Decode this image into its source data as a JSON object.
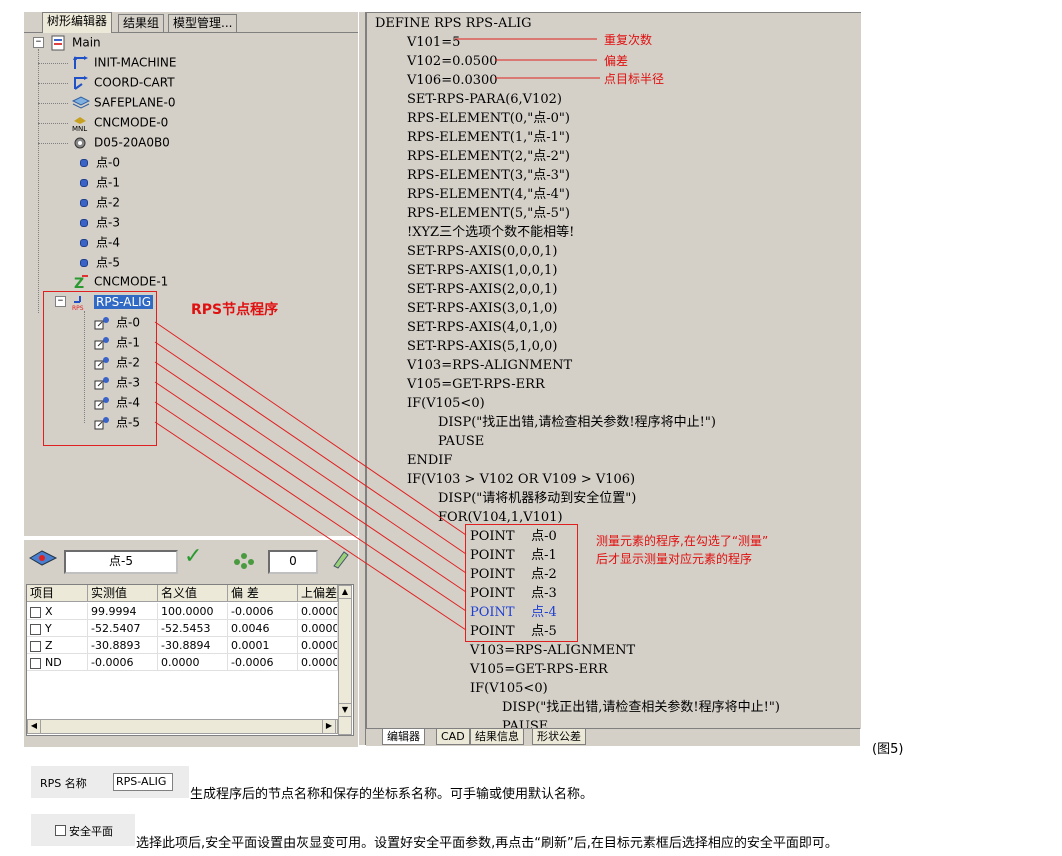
{
  "left_panel": {
    "tabs": [
      "树形编辑器",
      "结果组",
      "模型管理..."
    ],
    "tree": {
      "root": "Main",
      "items": [
        "INIT-MACHINE",
        "COORD-CART",
        "SAFEPLANE-0",
        "CNCMODE-0",
        "D05-20A0B0",
        "点-0",
        "点-1",
        "点-2",
        "点-3",
        "点-4",
        "点-5",
        "CNCMODE-1"
      ],
      "rps": {
        "label": "RPS-ALIG",
        "children": [
          "点-0",
          "点-1",
          "点-2",
          "点-3",
          "点-4",
          "点-5"
        ]
      }
    },
    "annotation": "RPS节点程序"
  },
  "bottom_panel": {
    "element_name": "点-5",
    "counter": "0",
    "columns": [
      "项目",
      "实测值",
      "名义值",
      "偏 差",
      "上偏差"
    ],
    "rows": [
      [
        "X",
        "99.9994",
        "100.0000",
        "-0.0006",
        "0.0000"
      ],
      [
        "Y",
        "-52.5407",
        "-52.5453",
        "0.0046",
        "0.0000"
      ],
      [
        "Z",
        "-30.8893",
        "-30.8894",
        "0.0001",
        "0.0000"
      ],
      [
        "ND",
        "-0.0006",
        "0.0000",
        "-0.0006",
        "0.0000"
      ]
    ]
  },
  "editor": {
    "lines": [
      "DEFINE RPS RPS-ALIG",
      "V101=5",
      "V102=0.0500",
      "V106=0.0300",
      "SET-RPS-PARA(6,V102)",
      "RPS-ELEMENT(0,\"点-0\")",
      "RPS-ELEMENT(1,\"点-1\")",
      "RPS-ELEMENT(2,\"点-2\")",
      "RPS-ELEMENT(3,\"点-3\")",
      "RPS-ELEMENT(4,\"点-4\")",
      "RPS-ELEMENT(5,\"点-5\")",
      "!XYZ三个选项个数不能相等!",
      "SET-RPS-AXIS(0,0,0,1)",
      "SET-RPS-AXIS(1,0,0,1)",
      "SET-RPS-AXIS(2,0,0,1)",
      "SET-RPS-AXIS(3,0,1,0)",
      "SET-RPS-AXIS(4,0,1,0)",
      "SET-RPS-AXIS(5,1,0,0)",
      "V103=RPS-ALIGNMENT",
      "V105=GET-RPS-ERR",
      "IF(V105<0)",
      "DISP(\"找正出错,请检查相关参数!程序将中止!\")",
      "PAUSE",
      "ENDIF",
      "IF(V103 > V102 OR V109 > V106)",
      "DISP(\"请将机器移动到安全位置\")",
      "FOR(V104,1,V101)",
      "POINT    点-0",
      "POINT    点-1",
      "POINT    点-2",
      "POINT    点-3",
      "POINT    点-4",
      "POINT    点-5",
      "V103=RPS-ALIGNMENT",
      "V105=GET-RPS-ERR",
      "IF(V105<0)",
      "DISP(\"找正出错,请检查相关参数!程序将中止!\")",
      "PAUSE"
    ],
    "annotations": {
      "repeat": "重复次数",
      "deviation": "偏差",
      "radius": "点目标半径",
      "measure_1": "测量元素的程序,在勾选了“测量”",
      "measure_2": "后才显示测量对应元素的程序"
    },
    "tabs": [
      "编辑器",
      "CAD",
      "结果信息",
      "形状公差"
    ]
  },
  "figure_label": "(图5)",
  "rps_name": {
    "label": "RPS 名称",
    "value": "RPS-ALIG",
    "description": "生成程序后的节点名称和保存的坐标系名称。可手输或使用默认名称。"
  },
  "safe_plane": {
    "label": "安全平面",
    "description": "选择此项后,安全平面设置由灰显变可用。设置好安全平面参数,再点击“刷新”后,在目标元素框后选择相应的安全平面即可。"
  },
  "colors": {
    "annotation": "#e01010",
    "selection": "#316ac5",
    "highlight_code": "#1f3fd0"
  }
}
